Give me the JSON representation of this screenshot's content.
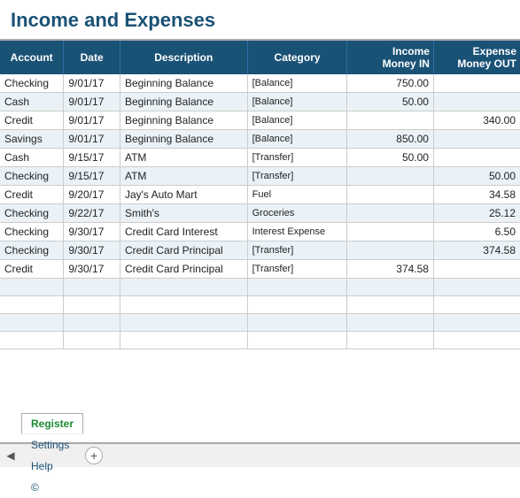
{
  "title": "Income and Expenses",
  "columns": [
    {
      "key": "account",
      "label": "Account"
    },
    {
      "key": "date",
      "label": "Date"
    },
    {
      "key": "description",
      "label": "Description"
    },
    {
      "key": "category",
      "label": "Category"
    },
    {
      "key": "income",
      "label": "Income\nMoney IN"
    },
    {
      "key": "expense",
      "label": "Expense\nMoney OUT"
    }
  ],
  "rows": [
    {
      "account": "Checking",
      "date": "9/01/17",
      "description": "Beginning Balance",
      "category": "[Balance]",
      "income": "750.00",
      "expense": ""
    },
    {
      "account": "Cash",
      "date": "9/01/17",
      "description": "Beginning Balance",
      "category": "[Balance]",
      "income": "50.00",
      "expense": ""
    },
    {
      "account": "Credit",
      "date": "9/01/17",
      "description": "Beginning Balance",
      "category": "[Balance]",
      "income": "",
      "expense": "340.00"
    },
    {
      "account": "Savings",
      "date": "9/01/17",
      "description": "Beginning Balance",
      "category": "[Balance]",
      "income": "850.00",
      "expense": ""
    },
    {
      "account": "Cash",
      "date": "9/15/17",
      "description": "ATM",
      "category": "[Transfer]",
      "income": "50.00",
      "expense": ""
    },
    {
      "account": "Checking",
      "date": "9/15/17",
      "description": "ATM",
      "category": "[Transfer]",
      "income": "",
      "expense": "50.00"
    },
    {
      "account": "Credit",
      "date": "9/20/17",
      "description": "Jay's Auto Mart",
      "category": "Fuel",
      "income": "",
      "expense": "34.58"
    },
    {
      "account": "Checking",
      "date": "9/22/17",
      "description": "Smith's",
      "category": "Groceries",
      "income": "",
      "expense": "25.12"
    },
    {
      "account": "Checking",
      "date": "9/30/17",
      "description": "Credit Card Interest",
      "category": "Interest Expense",
      "income": "",
      "expense": "6.50"
    },
    {
      "account": "Checking",
      "date": "9/30/17",
      "description": "Credit Card Principal",
      "category": "[Transfer]",
      "income": "",
      "expense": "374.58"
    },
    {
      "account": "Credit",
      "date": "9/30/17",
      "description": "Credit Card Principal",
      "category": "[Transfer]",
      "income": "374.58",
      "expense": ""
    }
  ],
  "empty_rows": 4,
  "tabs": [
    {
      "label": "Register",
      "active": true
    },
    {
      "label": "Settings",
      "active": false
    },
    {
      "label": "Help",
      "active": false
    },
    {
      "label": "©",
      "active": false
    }
  ],
  "tab_add_label": "+"
}
